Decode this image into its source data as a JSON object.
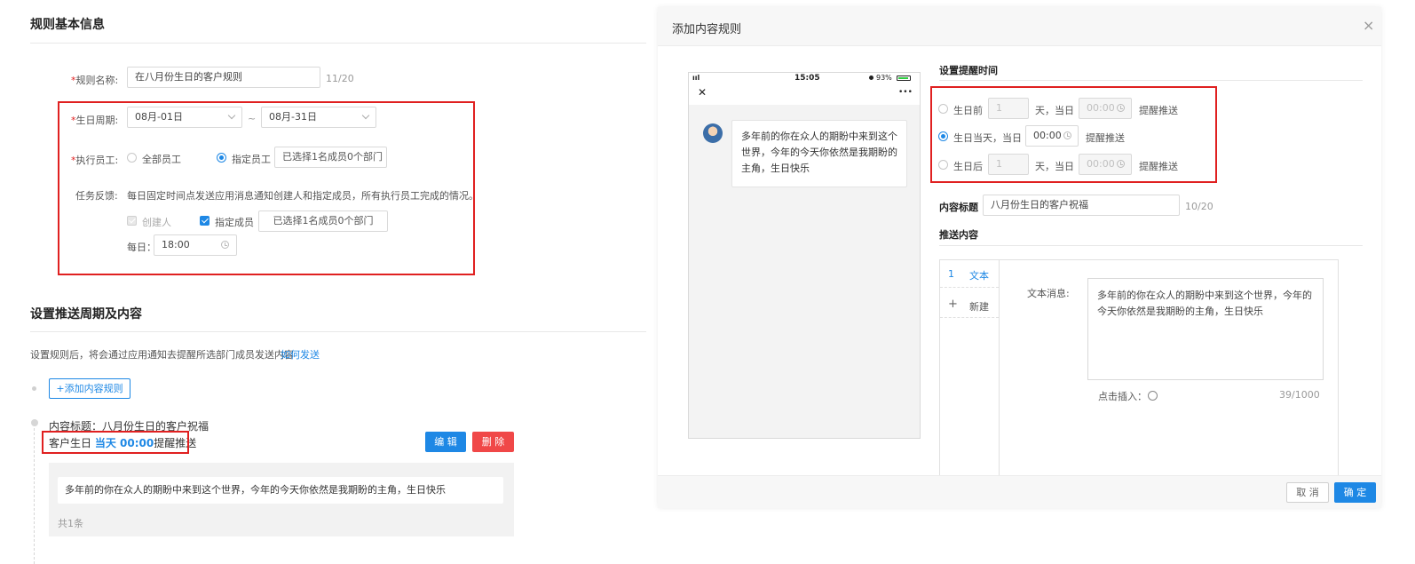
{
  "left": {
    "section1_title": "规则基本信息",
    "rule_name_label": "规则名称:",
    "rule_name_value": "在八月份生日的客户规则",
    "rule_name_count": "11/20",
    "birthday_label": "生日周期:",
    "birthday_start": "08月-01日",
    "birthday_sep": "~",
    "birthday_end": "08月-31日",
    "staff_label": "执行员工:",
    "staff_all": "全部员工",
    "staff_specified": "指定员工",
    "staff_selected": "已选择1名成员0个部门",
    "feedback_label": "任务反馈:",
    "feedback_desc": "每日固定时间点发送应用消息通知创建人和指定成员，所有执行员工完成的情况。",
    "creator_label": "创建人",
    "member_label": "指定成员",
    "member_selected": "已选择1名成员0个部门",
    "daily_label": "每日：",
    "daily_time": "18:00",
    "section2_title": "设置推送周期及内容",
    "push_desc": "设置规则后，将会通过应用通知去提醒所选部门成员发送内容",
    "how_send": "如何发送",
    "add_rule_button": "+添加内容规则",
    "content_title_text": "内容标题：八月份生日的客户祝福",
    "reminder_prefix": "客户生日",
    "reminder_highlight": "当天 00:00",
    "reminder_suffix": "提醒推送",
    "edit_button": "编 辑",
    "delete_button": "删 除",
    "message_text": "多年前的你在众人的期盼中来到这个世界，今年的今天你依然是我期盼的主角，生日快乐",
    "total_count": "共1条"
  },
  "modal": {
    "title": "添加内容规则",
    "close": "×",
    "phone_signal": "ııl",
    "phone_time": "15:05",
    "phone_battery": "93%",
    "phone_close": "✕",
    "phone_more": "•••",
    "phone_message": "多年前的你在众人的期盼中来到这个世界，今年的今天你依然是我期盼的主角，生日快乐",
    "remind_time_title": "设置提醒时间",
    "before_label": "生日前",
    "before_days": "1",
    "day_unit_1": "天，当日",
    "before_time": "00:00",
    "push_label_1": "提醒推送",
    "same_day_label": "生日当天，当日",
    "same_day_time": "00:00",
    "push_label_2": "提醒推送",
    "after_label": "生日后",
    "after_days": "1",
    "day_unit_2": "天，当日",
    "after_time": "00:00",
    "push_label_3": "提醒推送",
    "content_title_label": "内容标题",
    "content_title_value": "八月份生日的客户祝福",
    "content_title_count": "10/20",
    "push_content_title": "推送内容",
    "tab_index": "1",
    "tab_text": "文本",
    "new_plus": "+",
    "new_label": "新建",
    "text_msg_label": "文本消息:",
    "text_msg_value": "多年前的你在众人的期盼中来到这个世界，今年的今天你依然是我期盼的主角，生日快乐",
    "insert_label": "点击插入：",
    "text_count": "39/1000",
    "cancel_button": "取 消",
    "confirm_button": "确 定"
  },
  "colors": {
    "accent": "#1e88e5",
    "danger": "#f04848",
    "highlight_border": "#e02020"
  }
}
